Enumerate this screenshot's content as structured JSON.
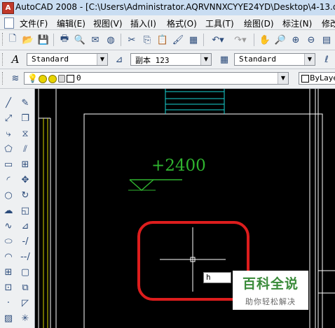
{
  "window": {
    "title": "AutoCAD 2008 - [C:\\Users\\Administrator.AQRVNNXCYYE24YD\\Desktop\\4-13.dw",
    "app_icon": "autocad-icon"
  },
  "menu": {
    "items": [
      "文件(F)",
      "编辑(E)",
      "视图(V)",
      "插入(I)",
      "格式(O)",
      "工具(T)",
      "绘图(D)",
      "标注(N)",
      "修改"
    ]
  },
  "styles": {
    "text_style": "Standard",
    "dim_style": "副本 123",
    "table_style": "Standard"
  },
  "layers": {
    "current_layer": "0",
    "linetype": "ByLaye"
  },
  "drawing": {
    "elevation_text": "+2400",
    "command_input": "h"
  },
  "watermark": {
    "title": "百科全说",
    "subtitle": "助你轻松解决"
  },
  "colors": {
    "canvas_bg": "#000000",
    "elevation_green": "#2fb32f",
    "cyan": "#19d3d3",
    "highlight_red": "#dd1d1d",
    "yellow": "#d8d800"
  }
}
